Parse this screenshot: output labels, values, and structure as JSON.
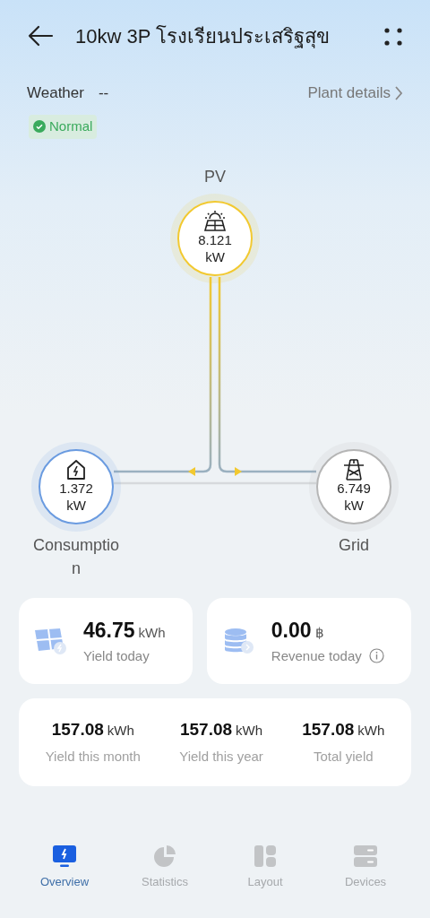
{
  "header": {
    "title": "10kw 3P โรงเรียนประเสริฐสุข"
  },
  "weather": {
    "label": "Weather",
    "value": "--"
  },
  "plant_details": {
    "label": "Plant details"
  },
  "status": {
    "label": "Normal",
    "kind": "normal"
  },
  "flow": {
    "nodes": [
      {
        "kind": "pv",
        "label": "PV",
        "value": "8.121",
        "unit": "kW",
        "color": "#f2c930"
      },
      {
        "kind": "consumption",
        "label": "Consumption",
        "value": "1.372",
        "unit": "kW",
        "color": "#6a9be0"
      },
      {
        "kind": "grid",
        "label": "Grid",
        "value": "6.749",
        "unit": "kW",
        "color": "#b5b5b5"
      }
    ]
  },
  "summary": [
    {
      "kind": "yield",
      "value": "46.75",
      "unit": "kWh",
      "label": "Yield today",
      "info": false
    },
    {
      "kind": "revenue",
      "value": "0.00",
      "unit": "฿",
      "label": "Revenue today",
      "info": true
    }
  ],
  "totals": [
    {
      "value": "157.08",
      "unit": "kWh",
      "label": "Yield this month"
    },
    {
      "value": "157.08",
      "unit": "kWh",
      "label": "Yield this year"
    },
    {
      "value": "157.08",
      "unit": "kWh",
      "label": "Total yield"
    }
  ],
  "tabs": [
    {
      "kind": "overview",
      "label": "Overview",
      "selected": true
    },
    {
      "kind": "statistics",
      "label": "Statistics",
      "selected": false
    },
    {
      "kind": "layout",
      "label": "Layout",
      "selected": false
    },
    {
      "kind": "devices",
      "label": "Devices",
      "selected": false
    }
  ]
}
